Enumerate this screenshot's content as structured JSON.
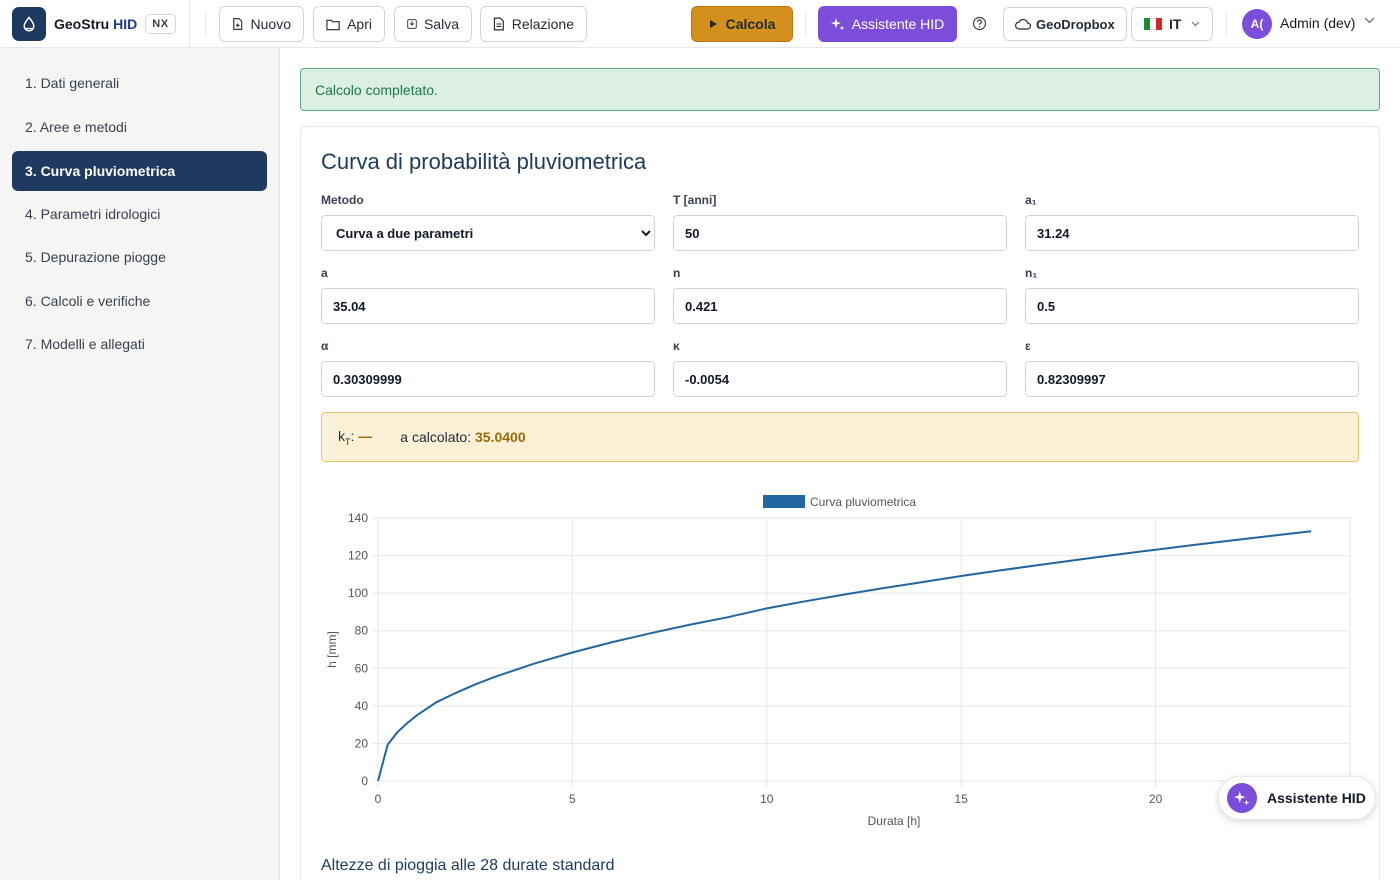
{
  "header": {
    "brand_name": "GeoStru",
    "brand_product": "HID",
    "brand_badge": "NX",
    "buttons": {
      "new": "Nuovo",
      "open": "Apri",
      "save": "Salva",
      "report": "Relazione"
    },
    "calcola": "Calcola",
    "assistant": "Assistente HID",
    "geodropbox": "GeoDropbox",
    "language": "IT",
    "user_initials": "A(",
    "user_name": "Admin (dev)"
  },
  "sidebar": {
    "items": [
      {
        "label": "1. Dati generali",
        "active": false
      },
      {
        "label": "2. Aree e metodi",
        "active": false
      },
      {
        "label": "3. Curva pluviometrica",
        "active": true
      },
      {
        "label": "4. Parametri idrologici",
        "active": false
      },
      {
        "label": "5. Depurazione piogge",
        "active": false
      },
      {
        "label": "6. Calcoli e verifiche",
        "active": false
      },
      {
        "label": "7. Modelli e allegati",
        "active": false
      }
    ]
  },
  "alert": {
    "text": "Calcolo completato."
  },
  "card": {
    "title": "Curva di probabilità pluviometrica",
    "fields": {
      "metodo": {
        "label": "Metodo",
        "value": "Curva a due parametri"
      },
      "T": {
        "label": "T [anni]",
        "value": "50"
      },
      "a1": {
        "label": "a₁",
        "value": "31.24"
      },
      "a": {
        "label": "a",
        "value": "35.04"
      },
      "n": {
        "label": "n",
        "value": "0.421"
      },
      "n1": {
        "label": "n₁",
        "value": "0.5"
      },
      "alpha": {
        "label": "α",
        "value": "0.30309999"
      },
      "kappa": {
        "label": "κ",
        "value": "-0.0054"
      },
      "epsilon": {
        "label": "ε",
        "value": "0.82309997"
      }
    },
    "info": {
      "kt_label": "k",
      "kt_sub": "T",
      "kt_value": "—",
      "a_calc_label": "a calcolato:",
      "a_calc_value": "35.0400"
    },
    "section_title": "Altezze di pioggia alle 28 durate standard"
  },
  "chart_data": {
    "type": "line",
    "series": [
      {
        "name": "Curva pluviometrica",
        "color": "#2266a0",
        "x": [
          0,
          0.25,
          0.5,
          0.75,
          1,
          1.5,
          2,
          2.5,
          3,
          4,
          5,
          6,
          7,
          8,
          9,
          10,
          11,
          12,
          13,
          14,
          15,
          16,
          17,
          18,
          19,
          20,
          21,
          22,
          23,
          24
        ],
        "y": [
          0,
          19.4,
          26.0,
          30.8,
          35.0,
          41.9,
          46.9,
          51.4,
          55.4,
          62.4,
          68.4,
          73.8,
          78.6,
          83.1,
          87.2,
          91.9,
          95.7,
          99.3,
          102.7,
          105.9,
          109.1,
          112.1,
          115.0,
          117.8,
          120.5,
          123.1,
          125.7,
          128.2,
          130.6,
          133.0
        ]
      }
    ],
    "xlabel": "Durata [h]",
    "ylabel": "h [mm]",
    "xlim": [
      0,
      25
    ],
    "ylim": [
      0,
      140
    ],
    "xticks": [
      0,
      5,
      10,
      15,
      20
    ],
    "yticks": [
      0,
      20,
      40,
      60,
      80,
      100,
      120,
      140
    ],
    "grid": true,
    "legend": "top"
  },
  "fab": {
    "label": "Assistente HID"
  }
}
